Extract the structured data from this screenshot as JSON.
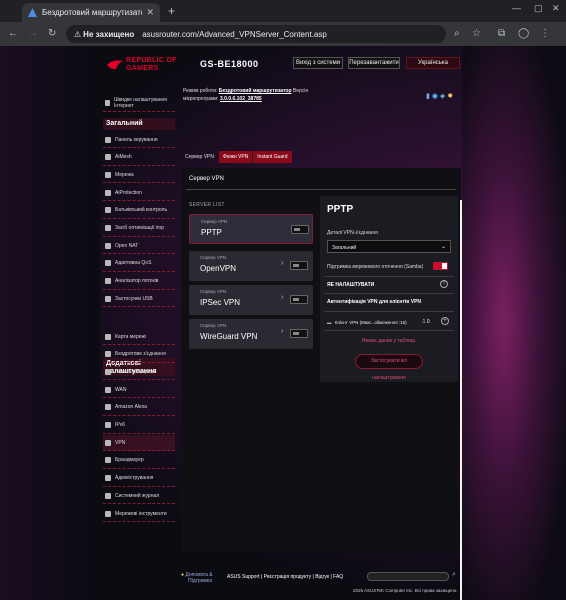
{
  "browser": {
    "tab_title": "Бездротовий маршрутизатор A",
    "security_label": "Не захищено",
    "url": "asusrouter.com/Advanced_VPNServer_Content.asp"
  },
  "header": {
    "logo_line1": "REPUBLIC OF",
    "logo_line2": "GAMERS",
    "model": "GS-BE18000",
    "logout": "Вихід з системи",
    "reboot": "Перезавантажити",
    "language": "Українська"
  },
  "mode": {
    "label": "Режим роботи:",
    "value": "Бездротовий маршрутизатор",
    "version_label": "Версія",
    "fw_label": "мікропрограми:",
    "fw_value": "3.0.0.6.102_38785"
  },
  "sidebar": {
    "top_item": "Швидке налаштування Інтернет",
    "general_title": "Загальний",
    "general_items": [
      "Панель керування",
      "AiMesh",
      "Мережа",
      "AiProtection",
      "Батьківський контроль",
      "Засіб оптимізації ігор",
      "Open NAT",
      "Адаптивна QoS",
      "Аналізатор потоків",
      "Застосунки USB"
    ],
    "advanced_title": "Додаткові налаштування",
    "advanced_items": [
      "Карта мережі",
      "Бездротове з'єднання",
      "Локальна мережа",
      "WAN",
      "Amazon Alexa",
      "IPv6",
      "VPN",
      "Брандмауер",
      "Адміністрування",
      "Системний журнал",
      "Мережеві інструменти"
    ]
  },
  "subtabs": [
    "Сервер VPN",
    "Фюжн VPN",
    "Instant Guard"
  ],
  "main": {
    "title": "Сервер VPN",
    "server_list_label": "SERVER LIST",
    "servers": [
      {
        "label": "Сервер VPN",
        "name": "PPTP"
      },
      {
        "label": "Сервер VPN",
        "name": "OpenVPN"
      },
      {
        "label": "Сервер VPN",
        "name": "IPSec VPN"
      },
      {
        "label": "Сервер VPN",
        "name": "WireGuard VPN"
      }
    ]
  },
  "panel": {
    "title": "PPTP",
    "details_label": "Деталі VPN-з'єднання",
    "details_value": "Загальний",
    "samba_label": "Підтримка мережевого оточення (Samba)",
    "not_configured": "ЯЕ НАЛАШТУВАТИ",
    "auth_title": "Автентифікація VPN для клієнтів VPN",
    "client_label": "Клієнт VPN (Макс. обмеження :16)",
    "client_count": "0",
    "no_data": "Немає даних у таблиці.",
    "apply_line1": "Застосувати всі",
    "apply_line2": "налаштування"
  },
  "footer": {
    "help_line1": "Допомога &",
    "help_line2": "Підтримка",
    "links": "ASUS Support | Реєстрація продукту | Відгук | FAQ",
    "copyright": "2025 ASUSTeK Computer Inc. Всі права захищено."
  },
  "colors": {
    "accent": "#c8102e",
    "link": "#e05070"
  }
}
